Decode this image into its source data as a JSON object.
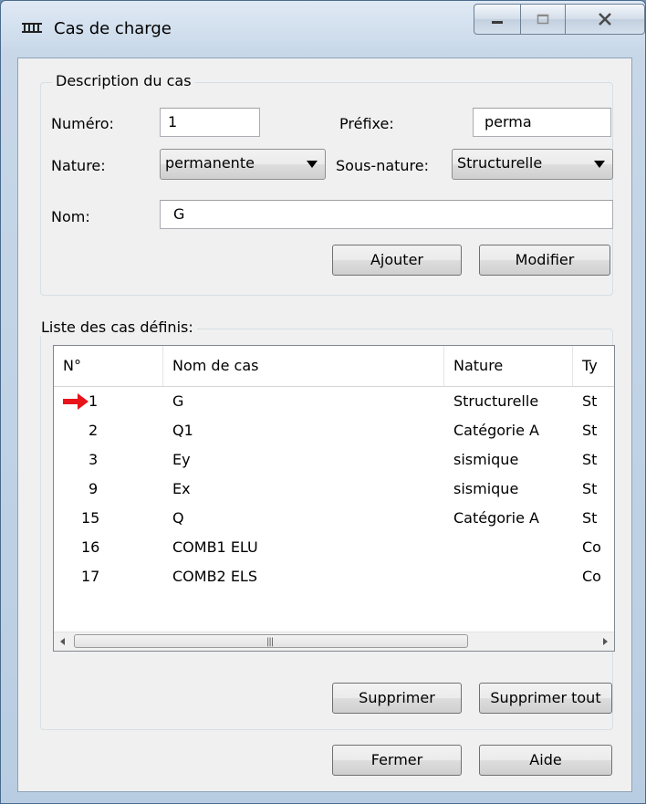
{
  "window": {
    "title": "Cas de charge",
    "controls": {
      "minimize": "minimize",
      "maximize": "maximize",
      "close": "close"
    }
  },
  "description": {
    "legend": "Description du cas",
    "numero_label": "Numéro:",
    "numero_value": "1",
    "prefixe_label": "Préfixe:",
    "prefixe_value": "perma",
    "nature_label": "Nature:",
    "nature_value": "permanente",
    "sous_nature_label": "Sous-nature:",
    "sous_nature_value": "Structurelle",
    "nom_label": "Nom:",
    "nom_value": "G",
    "ajouter_label": "Ajouter",
    "modifier_label": "Modifier"
  },
  "liste": {
    "legend": "Liste des cas définis:",
    "columns": [
      "N°",
      "Nom de cas",
      "Nature",
      "Ty"
    ],
    "rows": [
      {
        "num": "1",
        "nom": "G",
        "nature": "Structurelle",
        "type": "St",
        "current": true
      },
      {
        "num": "2",
        "nom": "Q1",
        "nature": "Catégorie A",
        "type": "St"
      },
      {
        "num": "3",
        "nom": "Ey",
        "nature": "sismique",
        "type": "St"
      },
      {
        "num": "9",
        "nom": "Ex",
        "nature": "sismique",
        "type": "St"
      },
      {
        "num": "15",
        "nom": "Q",
        "nature": "Catégorie A",
        "type": "St"
      },
      {
        "num": "16",
        "nom": "COMB1 ELU",
        "nature": "",
        "type": "Co"
      },
      {
        "num": "17",
        "nom": "COMB2 ELS",
        "nature": "",
        "type": "Co"
      }
    ],
    "supprimer_label": "Supprimer",
    "supprimer_tout_label": "Supprimer tout"
  },
  "footer": {
    "fermer_label": "Fermer",
    "aide_label": "Aide"
  },
  "colors": {
    "arrow": "#e8141a"
  }
}
